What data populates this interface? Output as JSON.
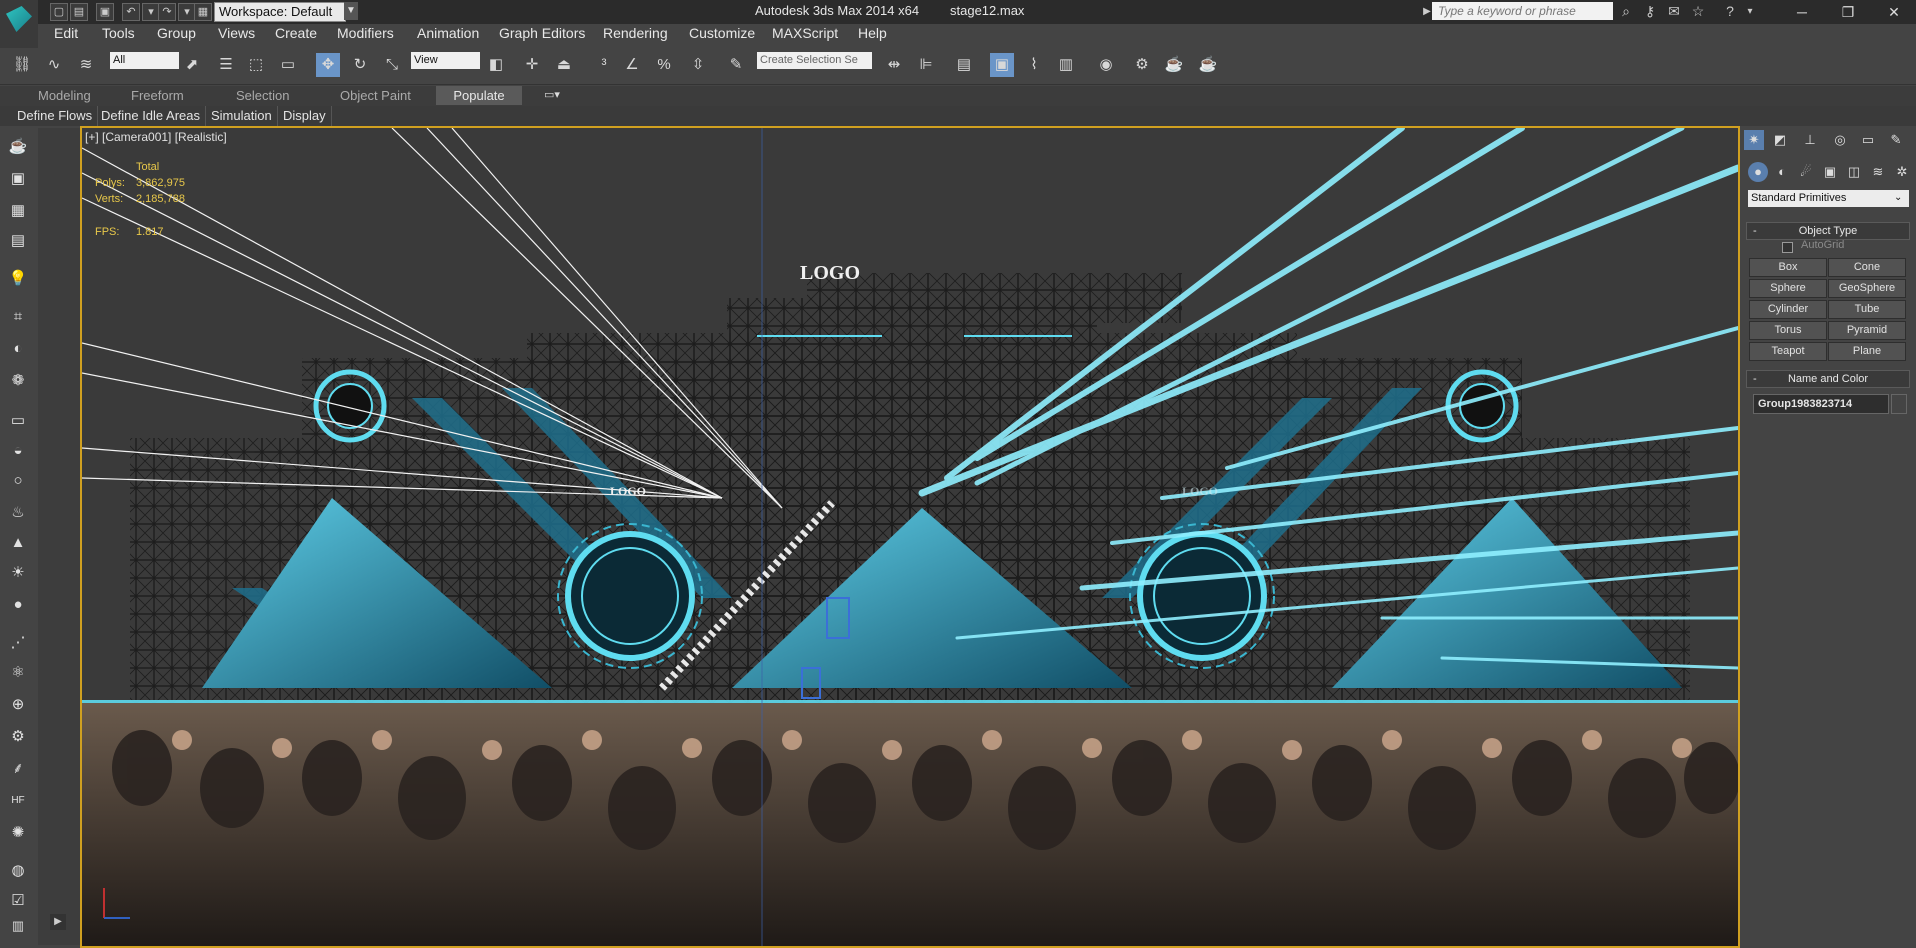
{
  "title_bar": {
    "app_title": "Autodesk 3ds Max  2014 x64",
    "file_name": "stage12.max",
    "workspace_label": "Workspace: Default",
    "search_placeholder": "Type a keyword or phrase"
  },
  "menu": [
    "Edit",
    "Tools",
    "Group",
    "Views",
    "Create",
    "Modifiers",
    "Animation",
    "Graph Editors",
    "Rendering",
    "Customize",
    "MAXScript",
    "Help"
  ],
  "toolbar": {
    "selection_filter": "All",
    "reference_coord": "View",
    "named_selection_placeholder": "Create Selection Se"
  },
  "ribbon": {
    "tabs": [
      "Modeling",
      "Freeform",
      "Selection",
      "Object Paint",
      "Populate"
    ],
    "active_tab": "Populate",
    "subtabs": [
      "Define Flows",
      "Define Idle Areas",
      "Simulation",
      "Display"
    ]
  },
  "viewport": {
    "label": "[+] [Camera001] [Realistic]",
    "stats_header": "Total",
    "polys_label": "Polys:",
    "polys_value": "3,862,975",
    "verts_label": "Verts:",
    "verts_value": "2,185,788",
    "fps_label": "FPS:",
    "fps_value": "1.817",
    "scene_logo_top": "LOGO",
    "scene_logo_left": "LOGO",
    "scene_logo_right": "LOGO"
  },
  "command_panel": {
    "primitive_type": "Standard Primitives",
    "object_type_header": "Object Type",
    "autogrid_label": "AutoGrid",
    "buttons": [
      "Box",
      "Cone",
      "Sphere",
      "GeoSphere",
      "Cylinder",
      "Tube",
      "Torus",
      "Pyramid",
      "Teapot",
      "Plane"
    ],
    "name_color_header": "Name and Color",
    "object_name": "Group1983823714"
  }
}
